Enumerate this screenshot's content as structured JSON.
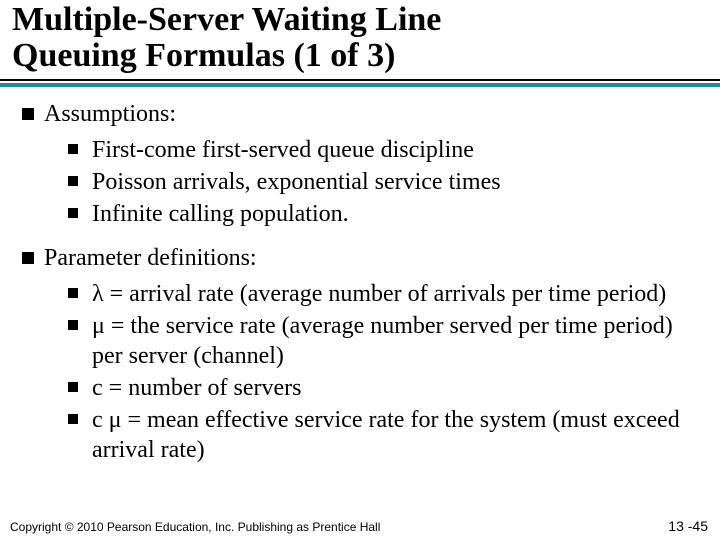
{
  "title_line1": "Multiple-Server Waiting Line",
  "title_line2": "Queuing Formulas (1 of 3)",
  "sec1": {
    "heading": "Assumptions:",
    "items": [
      "First-come first-served queue discipline",
      "Poisson arrivals, exponential service times",
      "Infinite calling population."
    ]
  },
  "sec2": {
    "heading": "Parameter definitions:",
    "items": [
      "λ = arrival rate (average number of arrivals per time  period)",
      "μ = the service rate (average number served per time period) per server (channel)",
      "c = number of servers",
      "c μ = mean effective service rate for the system (must exceed arrival rate)"
    ]
  },
  "footer": {
    "copyright": "Copyright © 2010 Pearson Education, Inc. Publishing as Prentice Hall",
    "pagenum": "13 -45"
  }
}
